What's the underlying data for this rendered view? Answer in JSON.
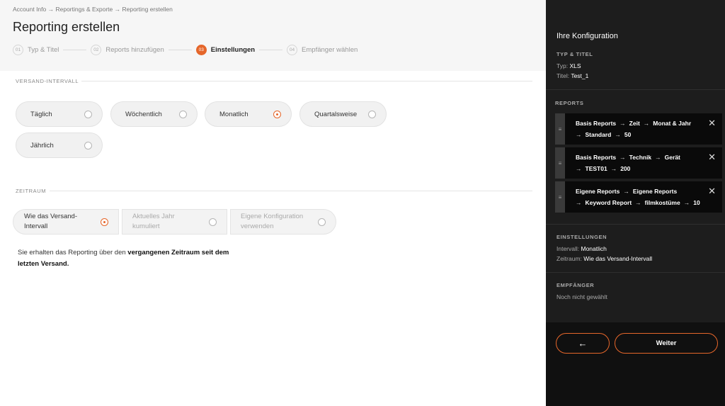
{
  "breadcrumb": "Account Info → Reportings & Exporte → Reporting erstellen",
  "page_title": "Reporting erstellen",
  "steps": [
    {
      "num": "01",
      "label": "Typ & Titel"
    },
    {
      "num": "02",
      "label": "Reports hinzufügen"
    },
    {
      "num": "03",
      "label": "Einstellungen"
    },
    {
      "num": "04",
      "label": "Empfänger wählen"
    }
  ],
  "active_step": "03",
  "versand": {
    "label": "Versand-Intervall",
    "options": [
      "Täglich",
      "Wöchentlich",
      "Monatlich",
      "Quartalsweise",
      "Jährlich"
    ],
    "selected": "Monatlich"
  },
  "zeitraum": {
    "label": "Zeitraum",
    "options": [
      {
        "line1": "Wie das Versand-",
        "line2": "Intervall"
      },
      {
        "line1": "Aktuelles Jahr",
        "line2": "kumuliert"
      },
      {
        "line1": "Eigene Konfiguration",
        "line2": "verwenden"
      }
    ],
    "selected_index": 0,
    "info_prefix": "Sie erhalten das Reporting über den ",
    "info_bold": "vergangenen Zeitraum seit dem letzten Versand."
  },
  "sidebar": {
    "title": "Ihre Konfiguration",
    "typ_titel": {
      "label": "Typ & Titel",
      "typ_key": "Typ:",
      "typ_value": "XLS",
      "titel_key": "Titel:",
      "titel_value": "Test_1"
    },
    "reports": {
      "label": "Reports",
      "items": [
        {
          "path": [
            "Basis Reports",
            "Zeit",
            "Monat & Jahr",
            "Standard",
            "50"
          ]
        },
        {
          "path": [
            "Basis Reports",
            "Technik",
            "Gerät",
            "TEST01",
            "200"
          ]
        },
        {
          "path": [
            "Eigene Reports",
            "Eigene Reports",
            "Keyword Report",
            "filmkostüme",
            "10"
          ]
        }
      ]
    },
    "einstellungen": {
      "label": "Einstellungen",
      "intervall_key": "Intervall:",
      "intervall_value": "Monatlich",
      "zeitraum_key": "Zeitraum:",
      "zeitraum_value": "Wie das Versand-Intervall"
    },
    "empfaenger": {
      "label": "Empfänger",
      "value": "Noch nicht gewählt"
    },
    "back_label": "←",
    "next_label": "Weiter"
  },
  "colors": {
    "accent": "#e5662a",
    "sidebar_bg": "#1d1d1d",
    "header_bg": "#f6f6f6"
  },
  "icons": {
    "drag_handle": "drag-handle-icon",
    "close": "close-icon",
    "back_arrow": "arrow-left-icon",
    "step_arrow": "arrow-right-icon"
  }
}
